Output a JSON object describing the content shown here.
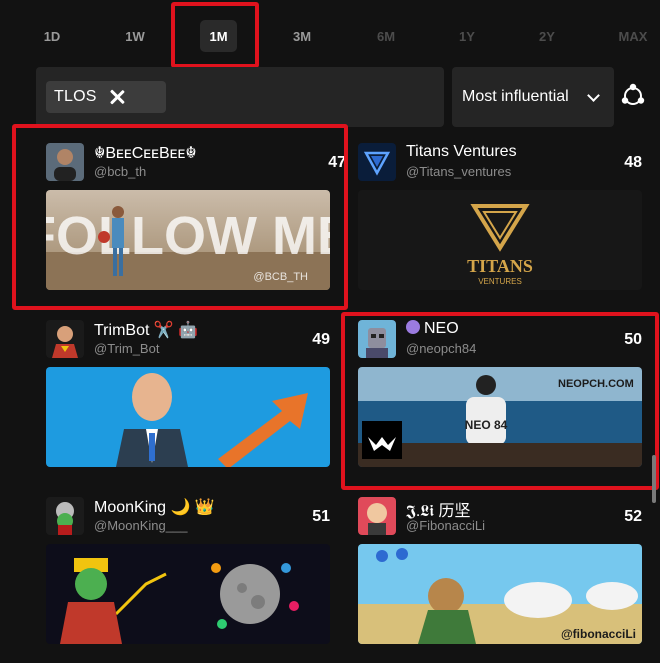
{
  "time_tabs": [
    {
      "label": "1D",
      "state": "normal"
    },
    {
      "label": "1W",
      "state": "normal"
    },
    {
      "label": "1M",
      "state": "active"
    },
    {
      "label": "3M",
      "state": "normal"
    },
    {
      "label": "6M",
      "state": "disabled"
    },
    {
      "label": "1Y",
      "state": "disabled"
    },
    {
      "label": "2Y",
      "state": "disabled"
    },
    {
      "label": "MAX",
      "state": "disabled"
    }
  ],
  "filter": {
    "chip_label": "TLOS",
    "remove_icon": "close-icon"
  },
  "sort": {
    "selected": "Most influential",
    "icon": "chevron-down-icon"
  },
  "network_icon": "network-icon",
  "colors": {
    "background": "#121212",
    "panel": "#252525",
    "highlight": "#e0121d",
    "muted": "#8c8c8c"
  },
  "cards": [
    {
      "name": "☬BᴇᴇCᴇᴇBᴇᴇ☬",
      "handle": "@bcb_th",
      "rank": "47",
      "banner_text": "FOLLOW ME",
      "banner_sub": "@BCB_TH"
    },
    {
      "name": "Titans Ventures",
      "handle": "@Titans_ventures",
      "rank": "48",
      "banner_text": "TITANS",
      "banner_sub": "VENTURES"
    },
    {
      "name": "TrimBot ✂️ 🤖",
      "handle": "@Trim_Bot",
      "rank": "49",
      "banner_text": "",
      "banner_sub": ""
    },
    {
      "name": "NEO",
      "handle": "@neopch84",
      "rank": "50",
      "banner_text": "NEOPCH.COM",
      "banner_sub": "NEO 84"
    },
    {
      "name": "MoonKing 🌙 👑",
      "handle": "@MoonKing___",
      "rank": "51",
      "banner_text": "",
      "banner_sub": ""
    },
    {
      "name": "𝕵.𝕷𝖎 历坚",
      "handle": "@FibonacciLi",
      "rank": "52",
      "banner_text": "@fibonacciLi",
      "banner_sub": ""
    }
  ]
}
